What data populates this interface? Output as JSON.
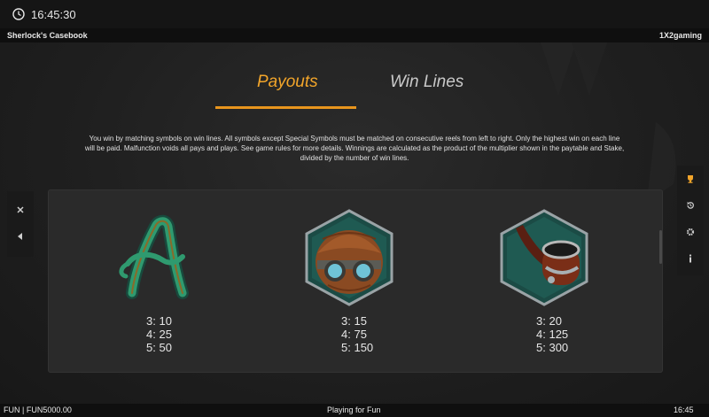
{
  "status_bar": {
    "time": "16:45:30",
    "icon": "clock-icon"
  },
  "title_bar": {
    "game_name": "Sherlock's Casebook",
    "provider": "1X2gaming"
  },
  "tabs": [
    {
      "label": "Payouts",
      "active": true
    },
    {
      "label": "Win Lines",
      "active": false
    }
  ],
  "description": "You win by matching symbols on win lines. All symbols except Special Symbols must be matched on consecutive reels from left to right. Only the highest win on each line will be paid. Malfunction voids all pays and plays. See game rules for more details. Winnings are calculated as the product of the multiplier shown in the paytable and Stake, divided by the number of win lines.",
  "symbols": [
    {
      "name": "letter-a-symbol",
      "payouts": [
        {
          "count": "3",
          "value": "10"
        },
        {
          "count": "4",
          "value": "25"
        },
        {
          "count": "5",
          "value": "50"
        }
      ]
    },
    {
      "name": "deerstalker-hat-symbol",
      "payouts": [
        {
          "count": "3",
          "value": "15"
        },
        {
          "count": "4",
          "value": "75"
        },
        {
          "count": "5",
          "value": "150"
        }
      ]
    },
    {
      "name": "pipe-symbol",
      "payouts": [
        {
          "count": "3",
          "value": "20"
        },
        {
          "count": "4",
          "value": "125"
        },
        {
          "count": "5",
          "value": "300"
        }
      ]
    }
  ],
  "left_sidebar": {
    "icons": [
      "close-icon",
      "arrow-left-icon"
    ]
  },
  "right_sidebar": {
    "icons": [
      "trophy-icon",
      "history-icon",
      "settings-icon",
      "info-icon"
    ]
  },
  "bottom_bar": {
    "balance": "FUN | FUN5000.00",
    "mode": "Playing for Fun",
    "time": "16:45"
  },
  "colors": {
    "accent": "#f2a52a",
    "background": "#1d1d1d",
    "panel": "#2a2a2a"
  }
}
